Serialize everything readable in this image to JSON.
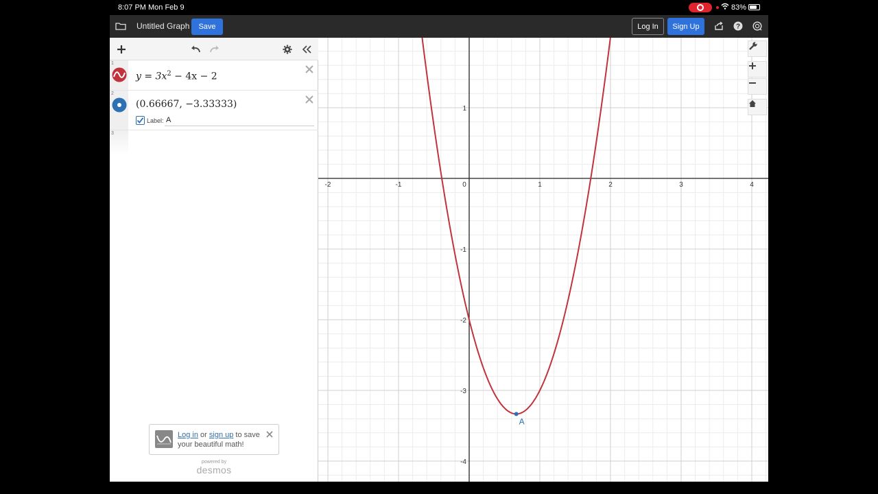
{
  "status_bar": {
    "time": "8:07 PM",
    "date": "Mon Feb 9",
    "battery": "83%"
  },
  "topbar": {
    "title": "Untitled Graph",
    "save": "Save",
    "login": "Log In",
    "signup": "Sign Up"
  },
  "expressions": [
    {
      "index": "1",
      "latex_base": "y = 3x",
      "latex_exp": "2",
      "latex_rest": " − 4x − 2",
      "color": "#c0323c"
    },
    {
      "index": "2",
      "text": "(0.66667, −3.33333)",
      "color": "#2d70b3",
      "label_caption": "Label:",
      "label_value": "A",
      "label_checked": true
    }
  ],
  "empty_row_index": "3",
  "save_prompt": {
    "login": "Log in",
    "or": " or ",
    "signup": "sign up",
    "rest": " to save your beautiful math!"
  },
  "powered_by": "powered by",
  "brand": "desmos",
  "graph": {
    "x_ticks": [
      "-2",
      "-1",
      "0",
      "1",
      "2",
      "3",
      "4"
    ],
    "y_ticks": [
      "1",
      "-1",
      "-2",
      "-3",
      "-4"
    ],
    "curve_color": "#c0323c",
    "point_color": "#2d70b3",
    "point_label": "A"
  }
}
